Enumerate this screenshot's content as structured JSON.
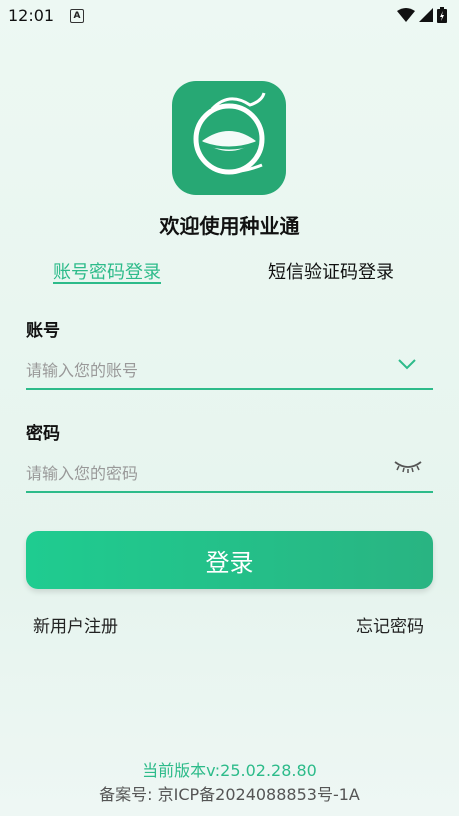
{
  "status_bar": {
    "time": "12:01",
    "a_badge": "A"
  },
  "app": {
    "title": "欢迎使用种业通",
    "logo_icon": "globe-leaf-logo"
  },
  "tabs": {
    "password_login": "账号密码登录",
    "sms_login": "短信验证码登录",
    "active": "password_login"
  },
  "account": {
    "label": "账号",
    "placeholder": "请输入您的账号"
  },
  "password": {
    "label": "密码",
    "placeholder": "请输入您的密码"
  },
  "actions": {
    "login": "登录",
    "register": "新用户注册",
    "forgot": "忘记密码"
  },
  "footer": {
    "version": "当前版本v:25.02.28.80",
    "icp": "备案号: 京ICP备2024088853号-1A"
  },
  "colors": {
    "accent": "#2dbb8a",
    "logo_bg": "#27a874"
  }
}
